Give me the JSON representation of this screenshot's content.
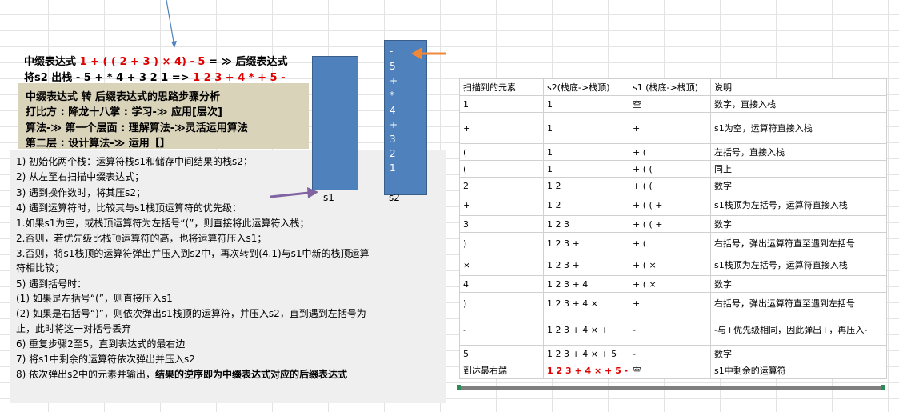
{
  "header": {
    "line1_prefix": "中缀表达式",
    "line1_expr": "1 + ( ( 2 + 3 )",
    "line1_times": "×",
    "line1_expr2": "4) - 5",
    "line1_suffix": "= ≫ 后缀表达式",
    "line2_prefix": "将s2 出栈  - 5 + * 4 + 3 2 1  =>",
    "line2_result": "1 2 3 + 4 * + 5 -"
  },
  "analysis_box": {
    "line1": "中缀表达式 转 后缀表达式的思路步骤分析",
    "line2": "打比方 :  降龙十八掌 : 学习-≫ 应用[层次]",
    "line3": "算法-≫ 第一个层面 :  理解算法-≫灵活运用算法",
    "line4": "第二层 :  设计算法-≫ 运用【】"
  },
  "steps": [
    "1) 初始化两个栈：运算符栈s1和储存中间结果的栈s2；",
    "2) 从左至右扫描中缀表达式；",
    "3) 遇到操作数时，将其压s2；",
    "4) 遇到运算符时，比较其与s1栈顶运算符的优先级：",
    "1.如果s1为空，或栈顶运算符为左括号“(”，则直接将此运算符入栈；",
    "2.否则，若优先级比栈顶运算符的高，也将运算符压入s1；",
    "3.否则，将s1栈顶的运算符弹出并压入到s2中，再次转到(4.1)与s1中新的栈顶运算",
    "符相比较；",
    "5) 遇到括号时：",
    "(1) 如果是左括号“(”，则直接压入s1",
    "(2) 如果是右括号“)”，则依次弹出s1栈顶的运算符，并压入s2，直到遇到左括号为",
    "止，此时将这一对括号丢弃",
    "6) 重复步骤2至5，直到表达式的最右边",
    "7) 将s1中剩余的运算符依次弹出并压入s2",
    "8)  依次弹出s2中的元素并输出，",
    "结果的逆序即为中缀表达式对应的后缀表达式"
  ],
  "stacks": {
    "s1_label": "s1",
    "s2_label": "s2",
    "s2_items": [
      "-",
      "5",
      "+",
      "*",
      "4",
      "+",
      "3",
      "2",
      "1"
    ]
  },
  "table": {
    "headers": [
      "扫描到的元素",
      "s2(栈底->栈顶)",
      "s1 (栈底->栈顶)",
      "说明"
    ],
    "rows": [
      [
        "1",
        "1",
        "空",
        "数字，直接入栈"
      ],
      [
        "+",
        "1",
        "+",
        "s1为空，运算符直接入栈"
      ],
      [
        "(",
        "1",
        "+ (",
        "左括号，直接入栈"
      ],
      [
        "(",
        "1",
        "+ ( (",
        "同上"
      ],
      [
        "2",
        "1 2",
        "+ ( (",
        "数字"
      ],
      [
        "+",
        "1 2",
        "+ ( ( +",
        "s1栈顶为左括号，运算符直接入栈"
      ],
      [
        "3",
        "1 2 3",
        "+ ( ( +",
        "数字"
      ],
      [
        ")",
        "1 2 3 +",
        "+ (",
        "右括号，弹出运算符直至遇到左括号"
      ],
      [
        "×",
        "1 2 3 +",
        "+ ( ×",
        "s1栈顶为左括号，运算符直接入栈"
      ],
      [
        "4",
        "1 2 3 + 4",
        "+ ( ×",
        "数字"
      ],
      [
        ")",
        "1 2 3 + 4 ×",
        "+",
        "右括号，弹出运算符直至遇到左括号"
      ],
      [
        "-",
        "1 2 3 + 4 × +",
        "-",
        "-与+优先级相同，因此弹出+，再压入-"
      ],
      [
        "5",
        "1 2 3 + 4 × + 5",
        "-",
        "数字"
      ],
      [
        "到达最右端",
        "1 2 3 + 4 × + 5 -",
        "空",
        "s1中剩余的运算符"
      ]
    ]
  },
  "colors": {
    "accent_red": "#e00000",
    "stack_blue": "#4f81bd",
    "arrow_orange": "#f0883a",
    "arrow_purple": "#8064a2",
    "analysis_bg": "#d9d3b9",
    "steps_bg": "#efefef"
  }
}
